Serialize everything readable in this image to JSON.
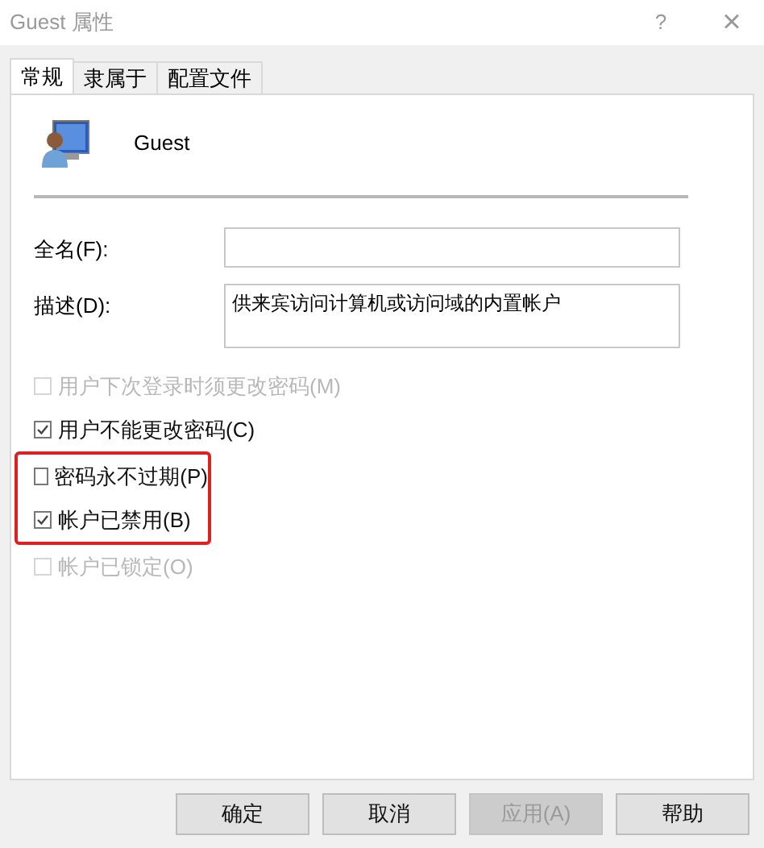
{
  "window": {
    "title": "Guest 属性",
    "help": "?",
    "close": "×"
  },
  "tabs": [
    {
      "label": "常规",
      "selected": true
    },
    {
      "label": "隶属于",
      "selected": false
    },
    {
      "label": "配置文件",
      "selected": false
    }
  ],
  "user": {
    "name": "Guest"
  },
  "fields": [
    {
      "label": "全名(F):",
      "multiline": false
    },
    {
      "label": "描述(D):",
      "value": "供来宾访问计算机或访问域的内置帐户",
      "multiline": true
    }
  ],
  "options": [
    {
      "label": "用户下次登录时须更改密码(M)",
      "checked": false,
      "disabled": true,
      "highlighted": false
    },
    {
      "label": "用户不能更改密码(C)",
      "checked": true,
      "disabled": false,
      "highlighted": false
    },
    {
      "label": "密码永不过期(P)",
      "checked": false,
      "disabled": false,
      "highlighted": true
    },
    {
      "label": "帐户已禁用(B)",
      "checked": true,
      "disabled": false,
      "highlighted": true
    },
    {
      "label": "帐户已锁定(O)",
      "checked": false,
      "disabled": true,
      "highlighted": false
    }
  ],
  "buttons": [
    {
      "label": "确定",
      "disabled": false
    },
    {
      "label": "取消",
      "disabled": false
    },
    {
      "label": "应用(A)",
      "disabled": true
    },
    {
      "label": "帮助",
      "disabled": false
    }
  ]
}
